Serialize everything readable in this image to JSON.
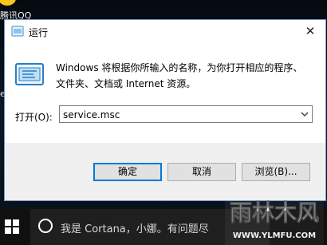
{
  "desktop": {
    "qq_label": "腾讯QQ",
    "edge_label": "e"
  },
  "dialog": {
    "title": "运行",
    "close_symbol": "✕",
    "description": "Windows 将根据你所输入的名称，为你打开相应的程序、文件夹、文档或 Internet 资源。",
    "open_label": "打开(O):",
    "open_value": "service.msc",
    "buttons": {
      "ok": "确定",
      "cancel": "取消",
      "browse": "浏览(B)..."
    }
  },
  "taskbar": {
    "search_placeholder": "我是 Cortana，小娜。有问题尽"
  },
  "watermark": {
    "text": "雨林木风",
    "url": "WWW.YLMFU.COM"
  },
  "colors": {
    "accent": "#0078d7",
    "taskbar": "#101010",
    "dialog_footer": "#f0f0f0"
  }
}
